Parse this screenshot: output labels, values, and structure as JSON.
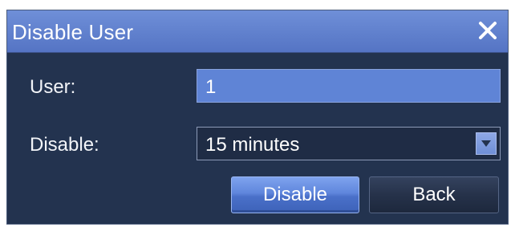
{
  "dialog": {
    "title": "Disable User",
    "close_icon": "close-icon"
  },
  "form": {
    "user_label": "User:",
    "user_value": "1",
    "disable_label": "Disable:",
    "disable_value": "15  minutes",
    "dropdown_icon": "chevron-down-icon"
  },
  "buttons": {
    "disable_label": "Disable",
    "back_label": "Back"
  },
  "colors": {
    "titlebar": "#6f8fd8",
    "dialog_bg": "#23334f",
    "user_field": "#5f84d6",
    "primary_button": "#5f86dc",
    "secondary_button": "#26324a"
  }
}
